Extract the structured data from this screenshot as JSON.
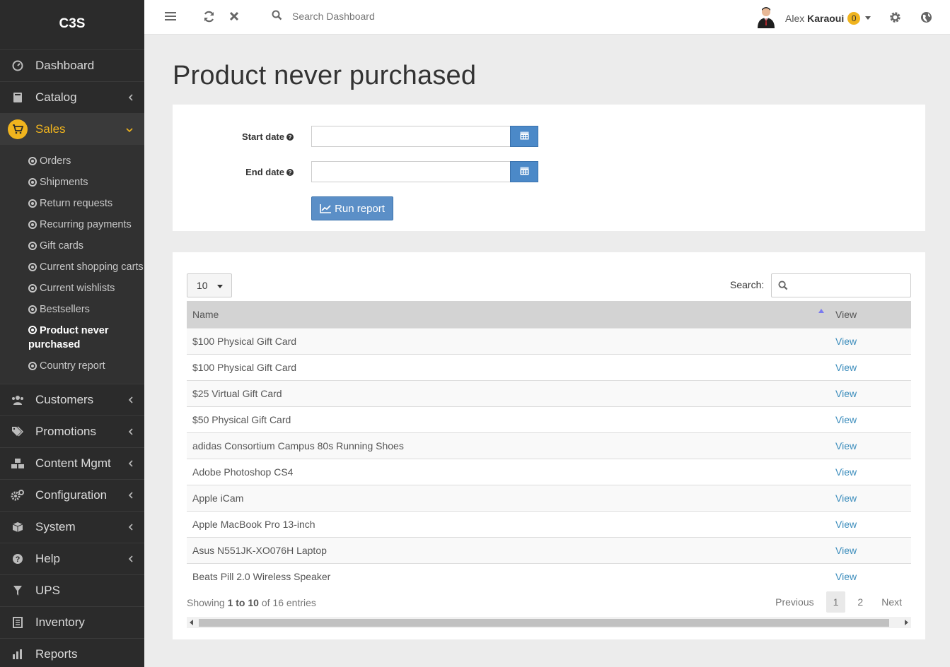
{
  "app": {
    "logo": "C3S"
  },
  "sidebar": {
    "items_top": [
      {
        "label": "Dashboard",
        "icon": "dashboard-icon"
      },
      {
        "label": "Catalog",
        "icon": "book-icon"
      }
    ],
    "active": {
      "label": "Sales",
      "icon": "cart-icon"
    },
    "sub_items": [
      {
        "label": "Orders"
      },
      {
        "label": "Shipments"
      },
      {
        "label": "Return requests"
      },
      {
        "label": "Recurring payments"
      },
      {
        "label": "Gift cards"
      },
      {
        "label": "Current shopping carts"
      },
      {
        "label": "Current wishlists"
      },
      {
        "label": "Bestsellers"
      },
      {
        "label": "Product never purchased"
      },
      {
        "label": "Country report"
      }
    ],
    "items_bottom": [
      {
        "label": "Customers",
        "icon": "users-icon"
      },
      {
        "label": "Promotions",
        "icon": "tags-icon"
      },
      {
        "label": "Content Mgmt",
        "icon": "cubes-icon"
      },
      {
        "label": "Configuration",
        "icon": "cogs-icon"
      },
      {
        "label": "System",
        "icon": "cube-icon"
      },
      {
        "label": "Help",
        "icon": "question-icon"
      },
      {
        "label": "UPS",
        "icon": "filter-icon"
      },
      {
        "label": "Inventory",
        "icon": "list-icon"
      },
      {
        "label": "Reports",
        "icon": "chart-icon"
      }
    ]
  },
  "header": {
    "search_placeholder": "Search Dashboard",
    "user_first": "Alex",
    "user_last": "Karaoui",
    "notification_count": "0"
  },
  "page": {
    "title": "Product never purchased"
  },
  "form": {
    "start_label": "Start date",
    "end_label": "End date",
    "run_label": "Run report"
  },
  "table": {
    "page_length": "10",
    "search_label": "Search:",
    "columns": [
      "Name",
      "View"
    ],
    "rows": [
      {
        "name": "$100 Physical Gift Card",
        "view": "View"
      },
      {
        "name": "$100 Physical Gift Card",
        "view": "View"
      },
      {
        "name": "$25 Virtual Gift Card",
        "view": "View"
      },
      {
        "name": "$50 Physical Gift Card",
        "view": "View"
      },
      {
        "name": "adidas Consortium Campus 80s Running Shoes",
        "view": "View"
      },
      {
        "name": "Adobe Photoshop CS4",
        "view": "View"
      },
      {
        "name": "Apple iCam",
        "view": "View"
      },
      {
        "name": "Apple MacBook Pro 13-inch",
        "view": "View"
      },
      {
        "name": "Asus N551JK-XO076H Laptop",
        "view": "View"
      },
      {
        "name": "Beats Pill 2.0 Wireless Speaker",
        "view": "View"
      }
    ],
    "info_prefix": "Showing",
    "info_range": "1 to 10",
    "info_suffix": "of 16 entries",
    "pager": {
      "previous": "Previous",
      "pages": [
        "1",
        "2"
      ],
      "next": "Next"
    }
  },
  "colors": {
    "accent": "#f0b41e",
    "sidebar_bg": "#2b2b2b",
    "primary_button": "#5b8fc7",
    "link": "#3c8dbc"
  }
}
